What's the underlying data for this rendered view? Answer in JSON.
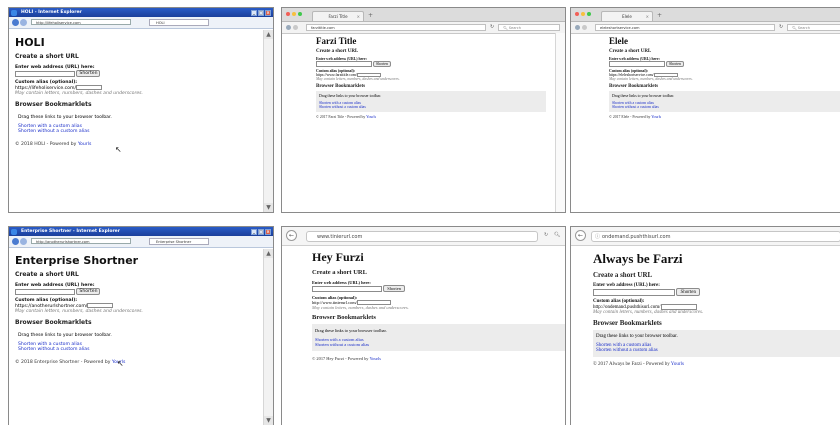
{
  "panels": [
    {
      "browser": "ie",
      "address": "http://lifeholiservice.com",
      "tab": "HOLI",
      "window_title": "HOLI - Internet Explorer",
      "title": "HOLI",
      "create_heading": "Create a short URL",
      "url_label": "Enter web address (URL) here:",
      "shorten": "Shorten",
      "alias_label": "Custom alias (optional):",
      "alias_prefix": "https://lifeholiservice.com/",
      "hint": "May contain letters, numbers, dashes and underscores.",
      "bm_heading": "Browser Bookmarklets",
      "drag": "Drag these links to your browser toolbar.",
      "link1": "Shorten with a custom alias",
      "link2": "Shorten without a custom alias",
      "footer_pre": "© 2018 HOLI - Powered by ",
      "footer_link": "Yourls"
    },
    {
      "browser": "firefox",
      "address": "farzititle.com",
      "tab": "Farzi Title",
      "search": "Search",
      "title": "Farzi Title",
      "create_heading": "Create a short URL",
      "url_label": "Enter web address (URL) here:",
      "shorten": "Shorten",
      "alias_label": "Custom alias (optional):",
      "alias_prefix": "https://www.farzititle.com/",
      "hint": "May contain letters, numbers, dashes and underscores.",
      "bm_heading": "Browser Bookmarklets",
      "drag": "Drag these links to your browser toolbar.",
      "link1": "Shorten with a custom alias",
      "link2": "Shorten without a custom alias",
      "footer_pre": "© 2017 Farzi Title - Powered by ",
      "footer_link": "Yourls"
    },
    {
      "browser": "firefox",
      "address": "eleleshortservice.com",
      "tab": "Elele",
      "search": "Search",
      "title": "Elele",
      "create_heading": "Create a short URL",
      "url_label": "Enter web address (URL) here:",
      "shorten": "Shorten",
      "alias_label": "Custom alias (optional):",
      "alias_prefix": "https://eleleshortservice.com/",
      "hint": "May contain letters, numbers, dashes and underscores.",
      "bm_heading": "Browser Bookmarklets",
      "drag": "Drag these links to your browser toolbar.",
      "link1": "Shorten with a custom alias",
      "link2": "Shorten without a custom alias",
      "footer_pre": "© 2017 Elele - Powered by ",
      "footer_link": "Yourls"
    },
    {
      "browser": "ie",
      "address": "http://anotherurlshortner.com",
      "tab": "Enterprise Shortner",
      "window_title": "Enterprise Shortner - Internet Explorer",
      "title": "Enterprise Shortner",
      "create_heading": "Create a short URL",
      "url_label": "Enter web address (URL) here:",
      "shorten": "Shorten",
      "alias_label": "Custom alias (optional):",
      "alias_prefix": "https://anotherurlshortner.com/",
      "hint": "May contain letters, numbers, dashes and underscores.",
      "bm_heading": "Browser Bookmarklets",
      "drag": "Drag these links to your browser toolbar.",
      "link1": "Shorten with a custom alias",
      "link2": "Shorten without a custom alias",
      "footer_pre": "© 2018 Enterprise Shortner - Powered by ",
      "footer_link": "Yourls"
    },
    {
      "browser": "big",
      "address": "www.tinierurl.com",
      "title": "Hey Furzi",
      "create_heading": "Create a short URL",
      "url_label": "Enter web address (URL) here:",
      "shorten": "Shorten",
      "alias_label": "Custom alias (optional):",
      "alias_prefix": "http://www.tinierurl.com/",
      "hint": "May contain letters, numbers, dashes and underscores.",
      "bm_heading": "Browser Bookmarklets",
      "drag": "Drag these links to your browser toolbar.",
      "link1": "Shorten with a custom alias",
      "link2": "Shorten without a custom alias",
      "footer_pre": "© 2017 Hey Furzi - Powered by ",
      "footer_link": "Yourls"
    },
    {
      "browser": "big",
      "address": "ondemand.pushthisurl.com",
      "title": "Always be Farzi",
      "create_heading": "Create a short URL",
      "url_label": "Enter web address (URL) here:",
      "shorten": "Shorten",
      "alias_label": "Custom alias (optional):",
      "alias_prefix": "http://ondemand.pushthisurl.com/",
      "hint": "May contain letters, numbers, dashes and underscores.",
      "bm_heading": "Browser Bookmarklets",
      "drag": "Drag these links to your browser toolbar.",
      "link1": "Shorten with a custom alias",
      "link2": "Shorten without a custom alias",
      "footer_pre": "© 2017 Always be Farzi - Powered by ",
      "footer_link": "Yourls"
    }
  ]
}
